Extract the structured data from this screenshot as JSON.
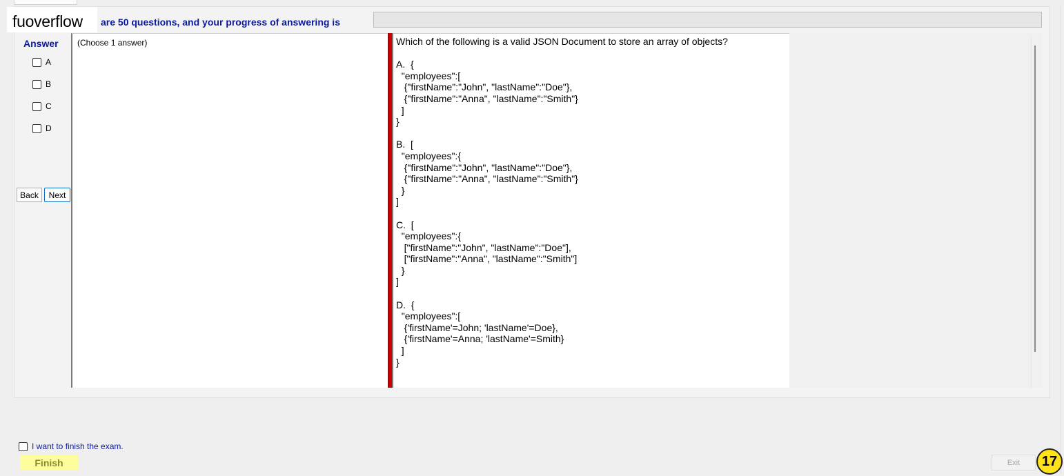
{
  "header": {
    "brand": "fuoverflow",
    "progress_label": "are 50 questions, and your progress of answering is",
    "progress_fraction": 0
  },
  "answer": {
    "title": "Answer",
    "options": [
      {
        "label": "A",
        "checked": false
      },
      {
        "label": "B",
        "checked": false
      },
      {
        "label": "C",
        "checked": false
      },
      {
        "label": "D",
        "checked": false
      }
    ]
  },
  "nav": {
    "back_label": "Back",
    "next_label": "Next"
  },
  "instructions": "(Choose 1 answer)",
  "question": {
    "lines": [
      "Which of the following is a valid JSON Document to store an array of objects?",
      "",
      "A.  {",
      "  \"employees\":[",
      "   {\"firstName\":\"John\", \"lastName\":\"Doe\"},",
      "   {\"firstName\":\"Anna\", \"lastName\":\"Smith\"}",
      "  ]",
      "}",
      "",
      "B.  [",
      "  \"employees\":{",
      "   {\"firstName\":\"John\", \"lastName\":\"Doe\"},",
      "   {\"firstName\":\"Anna\", \"lastName\":\"Smith\"}",
      "  }",
      "]",
      "",
      "C.  [",
      "  \"employees\":{",
      "   [\"firstName\":\"John\", \"lastName\":\"Doe\"],",
      "   [\"firstName\":\"Anna\", \"lastName\":\"Smith\"]",
      "  }",
      "]",
      "",
      "D.  {",
      "  \"employees\":[",
      "   {'firstName'=John; 'lastName'=Doe},",
      "   {'firstName'=Anna; 'lastName'=Smith}",
      "  ]",
      "}"
    ]
  },
  "footer": {
    "finish_check_label": "I want to finish the exam.",
    "finish_label": "Finish",
    "exit_label": "Exit",
    "page_number": "17"
  },
  "colors": {
    "accent_text": "#0b1a9c",
    "splitter": "#d40000",
    "finish_bg": "#fdfd9d",
    "badge": "#ffe21a"
  }
}
